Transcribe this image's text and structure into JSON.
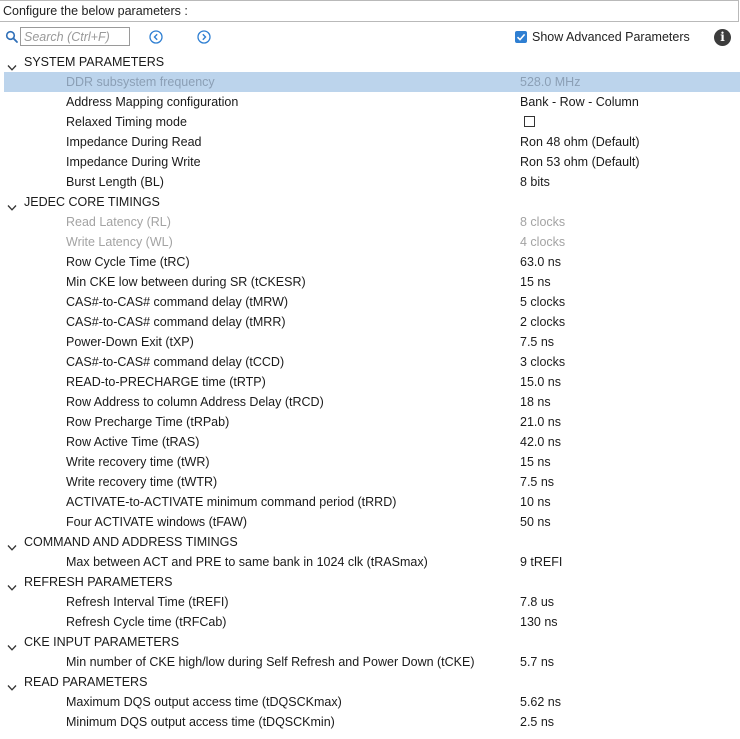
{
  "header": {
    "title": "Configure the below parameters :"
  },
  "toolbar": {
    "search_placeholder": "Search (Ctrl+F)",
    "show_advanced_label": "Show Advanced Parameters",
    "show_advanced_checked": true
  },
  "sections": [
    {
      "title": "SYSTEM PARAMETERS",
      "items": [
        {
          "name": "DDR subsystem frequency",
          "value": "528.0 MHz",
          "disabled": true,
          "selected": true
        },
        {
          "name": "Address Mapping configuration",
          "value": "Bank - Row - Column"
        },
        {
          "name": "Relaxed Timing mode",
          "value": "",
          "checkbox": true,
          "checked": false
        },
        {
          "name": "Impedance During Read",
          "value": "Ron 48 ohm (Default)"
        },
        {
          "name": "Impedance During Write",
          "value": "Ron 53 ohm (Default)"
        },
        {
          "name": "Burst Length (BL)",
          "value": "8 bits"
        }
      ]
    },
    {
      "title": "JEDEC CORE TIMINGS",
      "items": [
        {
          "name": "Read Latency (RL)",
          "value": "8 clocks",
          "disabled": true
        },
        {
          "name": "Write Latency (WL)",
          "value": "4 clocks",
          "disabled": true
        },
        {
          "name": "Row Cycle Time (tRC)",
          "value": "63.0 ns"
        },
        {
          "name": "Min CKE low between during SR (tCKESR)",
          "value": "15 ns"
        },
        {
          "name": "CAS#-to-CAS# command delay (tMRW)",
          "value": "5 clocks"
        },
        {
          "name": "CAS#-to-CAS# command delay (tMRR)",
          "value": "2 clocks"
        },
        {
          "name": "Power-Down Exit (tXP)",
          "value": "7.5 ns"
        },
        {
          "name": "CAS#-to-CAS# command delay (tCCD)",
          "value": "3 clocks"
        },
        {
          "name": "READ-to-PRECHARGE time (tRTP)",
          "value": "15.0 ns"
        },
        {
          "name": "Row Address to column Address Delay (tRCD)",
          "value": "18 ns"
        },
        {
          "name": "Row Precharge Time (tRPab)",
          "value": "21.0 ns"
        },
        {
          "name": "Row Active Time (tRAS)",
          "value": "42.0 ns"
        },
        {
          "name": "Write recovery time (tWR)",
          "value": "15 ns"
        },
        {
          "name": "Write recovery time (tWTR)",
          "value": "7.5 ns"
        },
        {
          "name": "ACTIVATE-to-ACTIVATE minimum command period (tRRD)",
          "value": "10 ns"
        },
        {
          "name": "Four ACTIVATE windows (tFAW)",
          "value": "50 ns"
        }
      ]
    },
    {
      "title": "COMMAND AND ADDRESS TIMINGS",
      "items": [
        {
          "name": "Max between ACT and PRE to same bank in 1024 clk (tRASmax)",
          "value": "9 tREFI"
        }
      ]
    },
    {
      "title": "REFRESH PARAMETERS",
      "items": [
        {
          "name": "Refresh Interval Time (tREFI)",
          "value": "7.8 us"
        },
        {
          "name": "Refresh Cycle time (tRFCab)",
          "value": "130 ns"
        }
      ]
    },
    {
      "title": "CKE INPUT PARAMETERS",
      "items": [
        {
          "name": "Min number of CKE high/low during Self Refresh and Power Down (tCKE)",
          "value": "5.7 ns"
        }
      ]
    },
    {
      "title": "READ PARAMETERS",
      "items": [
        {
          "name": "Maximum DQS output access time (tDQSCKmax)",
          "value": "5.62 ns"
        },
        {
          "name": "Minimum DQS output access time (tDQSCKmin)",
          "value": "2.5 ns"
        }
      ]
    }
  ],
  "colors": {
    "accent": "#2f7fd2",
    "selection": "#bcd4ec",
    "disabled_text": "#a3a3a3"
  }
}
